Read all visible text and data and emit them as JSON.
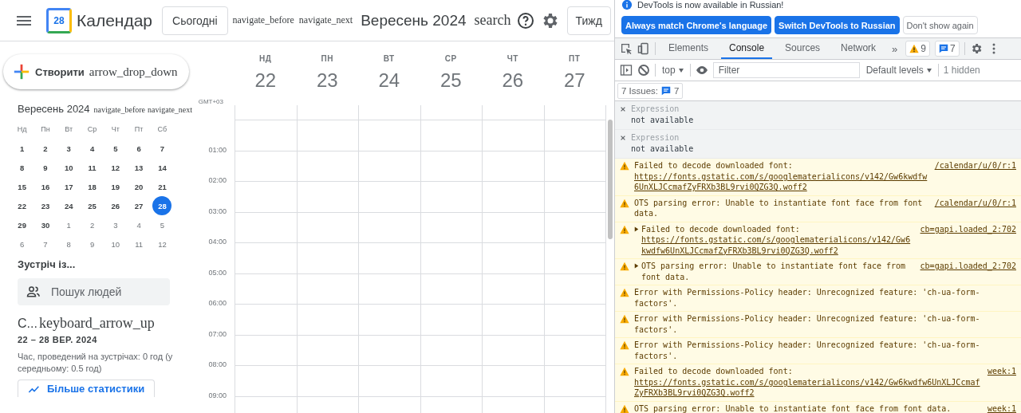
{
  "header": {
    "logo_day": "28",
    "title": "Календар",
    "today_button": "Сьогодні",
    "prev_icon_text": "navigate_before",
    "next_icon_text": "navigate_next",
    "period": "Вересень 2024",
    "search_icon_text": "search",
    "view_button": "Тижд"
  },
  "create_button": {
    "label": "Створити",
    "icon_text": "arrow_drop_down"
  },
  "mini_calendar": {
    "title": "Вересень 2024",
    "prev_icon_text": "navigate_before",
    "next_icon_text": "navigate_next",
    "weekdays": [
      "Нд",
      "Пн",
      "Вт",
      "Ср",
      "Чт",
      "Пт",
      "Сб"
    ],
    "weeks": [
      [
        {
          "day": "1",
          "other_month": false,
          "selected": false
        },
        {
          "day": "2",
          "other_month": false,
          "selected": false
        },
        {
          "day": "3",
          "other_month": false,
          "selected": false
        },
        {
          "day": "4",
          "other_month": false,
          "selected": false
        },
        {
          "day": "5",
          "other_month": false,
          "selected": false
        },
        {
          "day": "6",
          "other_month": false,
          "selected": false
        },
        {
          "day": "7",
          "other_month": false,
          "selected": false
        }
      ],
      [
        {
          "day": "8",
          "other_month": false,
          "selected": false
        },
        {
          "day": "9",
          "other_month": false,
          "selected": false
        },
        {
          "day": "10",
          "other_month": false,
          "selected": false
        },
        {
          "day": "11",
          "other_month": false,
          "selected": false
        },
        {
          "day": "12",
          "other_month": false,
          "selected": false
        },
        {
          "day": "13",
          "other_month": false,
          "selected": false
        },
        {
          "day": "14",
          "other_month": false,
          "selected": false
        }
      ],
      [
        {
          "day": "15",
          "other_month": false,
          "selected": false
        },
        {
          "day": "16",
          "other_month": false,
          "selected": false
        },
        {
          "day": "17",
          "other_month": false,
          "selected": false
        },
        {
          "day": "18",
          "other_month": false,
          "selected": false
        },
        {
          "day": "19",
          "other_month": false,
          "selected": false
        },
        {
          "day": "20",
          "other_month": false,
          "selected": false
        },
        {
          "day": "21",
          "other_month": false,
          "selected": false
        }
      ],
      [
        {
          "day": "22",
          "other_month": false,
          "selected": false
        },
        {
          "day": "23",
          "other_month": false,
          "selected": false
        },
        {
          "day": "24",
          "other_month": false,
          "selected": false
        },
        {
          "day": "25",
          "other_month": false,
          "selected": false
        },
        {
          "day": "26",
          "other_month": false,
          "selected": false
        },
        {
          "day": "27",
          "other_month": false,
          "selected": false
        },
        {
          "day": "28",
          "other_month": false,
          "selected": true
        }
      ],
      [
        {
          "day": "29",
          "other_month": false,
          "selected": false
        },
        {
          "day": "30",
          "other_month": false,
          "selected": false
        },
        {
          "day": "1",
          "other_month": true,
          "selected": false
        },
        {
          "day": "2",
          "other_month": true,
          "selected": false
        },
        {
          "day": "3",
          "other_month": true,
          "selected": false
        },
        {
          "day": "4",
          "other_month": true,
          "selected": false
        },
        {
          "day": "5",
          "other_month": true,
          "selected": false
        }
      ],
      [
        {
          "day": "6",
          "other_month": true,
          "selected": false
        },
        {
          "day": "7",
          "other_month": true,
          "selected": false
        },
        {
          "day": "8",
          "other_month": true,
          "selected": false
        },
        {
          "day": "9",
          "other_month": true,
          "selected": false
        },
        {
          "day": "10",
          "other_month": true,
          "selected": false
        },
        {
          "day": "11",
          "other_month": true,
          "selected": false
        },
        {
          "day": "12",
          "other_month": true,
          "selected": false
        }
      ]
    ]
  },
  "people": {
    "heading": "Зустріч із...",
    "search": {
      "placeholder": "Пошук людей"
    }
  },
  "stats": {
    "title": "С...",
    "icon_text": "keyboard_arrow_up",
    "range": "22 – 28 ВЕР. 2024",
    "summary": "Час, проведений на зустрічах: 0 год (у середньому: 0.5 год)",
    "button": "Більше статистики"
  },
  "week_view": {
    "timezone": "GMT+03",
    "days": [
      {
        "weekday": "НД",
        "date": "22"
      },
      {
        "weekday": "ПН",
        "date": "23"
      },
      {
        "weekday": "ВТ",
        "date": "24"
      },
      {
        "weekday": "СР",
        "date": "25"
      },
      {
        "weekday": "ЧТ",
        "date": "26"
      },
      {
        "weekday": "ПТ",
        "date": "27"
      }
    ],
    "hours": [
      "01:00",
      "02:00",
      "03:00",
      "04:00",
      "05:00",
      "06:00",
      "07:00",
      "08:00",
      "09:00"
    ]
  },
  "devtools": {
    "notice": {
      "text": "DevTools is now available in Russian!",
      "buttons": [
        {
          "label": "Always match Chrome's language",
          "primary": true
        },
        {
          "label": "Switch DevTools to Russian",
          "primary": true
        },
        {
          "label": "Don't show again",
          "primary": false
        }
      ]
    },
    "tabs": [
      {
        "label": "Elements",
        "selected": false
      },
      {
        "label": "Console",
        "selected": true
      },
      {
        "label": "Sources",
        "selected": false
      },
      {
        "label": "Network",
        "selected": false
      }
    ],
    "more_tabs": "»",
    "warning_count": "9",
    "message_count": "7",
    "console_toolbar": {
      "context": "top",
      "filter": {
        "placeholder": "Filter"
      },
      "levels": "Default levels",
      "hidden": "1 hidden"
    },
    "issues": {
      "label": "7 Issues:",
      "count": "7"
    },
    "messages": [
      {
        "kind": "expression",
        "label": "Expression",
        "value": "not available"
      },
      {
        "kind": "expression",
        "label": "Expression",
        "value": "not available"
      },
      {
        "kind": "warning",
        "expandable": false,
        "text": "Failed to decode downloaded font: ",
        "url": "https://fonts.gstatic.com/s/googlematerialicons/v142/Gw6kwdfw6UnXLJCcmafZyFRXb3BL9rvi0QZG3Q.woff2",
        "source": "/calendar/u/0/r:1"
      },
      {
        "kind": "warning",
        "expandable": false,
        "text": "OTS parsing error: Unable to instantiate font face from font data.",
        "source": "/calendar/u/0/r:1"
      },
      {
        "kind": "warning",
        "expandable": true,
        "text": "Failed to decode downloaded font: ",
        "url": "https://fonts.gstatic.com/s/googlematerialicons/v142/Gw6kwdfw6UnXLJCcmafZyFRXb3BL9rvi0QZG3Q.woff2",
        "source": "cb=gapi.loaded_2:702"
      },
      {
        "kind": "warning",
        "expandable": true,
        "text": "OTS parsing error: Unable to instantiate font face from font data.",
        "source": "cb=gapi.loaded_2:702"
      },
      {
        "kind": "warning",
        "expandable": false,
        "text": "Error with Permissions-Policy header: Unrecognized feature: 'ch-ua-form-factors'."
      },
      {
        "kind": "warning",
        "expandable": false,
        "text": "Error with Permissions-Policy header: Unrecognized feature: 'ch-ua-form-factors'."
      },
      {
        "kind": "warning",
        "expandable": false,
        "text": "Error with Permissions-Policy header: Unrecognized feature: 'ch-ua-form-factors'."
      },
      {
        "kind": "warning",
        "expandable": false,
        "text": "Failed to decode downloaded font: ",
        "url": "https://fonts.gstatic.com/s/googlematerialicons/v142/Gw6kwdfw6UnXLJCcmafZyFRXb3BL9rvi0QZG3Q.woff2",
        "source": "week:1"
      },
      {
        "kind": "warning",
        "expandable": false,
        "text": "OTS parsing error: Unable to instantiate font face from font data.",
        "source": "week:1"
      }
    ]
  }
}
